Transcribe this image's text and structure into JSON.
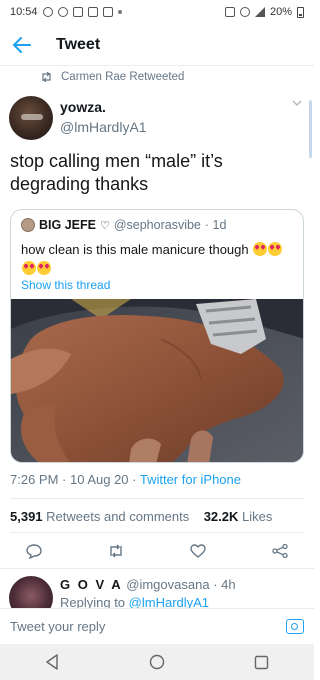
{
  "status_bar": {
    "time": "10:54",
    "battery": "20%"
  },
  "header": {
    "title": "Tweet",
    "back_icon": "arrow-left-icon"
  },
  "retweet_banner": {
    "text": "Carmen Rae Retweeted"
  },
  "tweet": {
    "display_name": "yowza.",
    "handle": "@lmHardlyA1",
    "text": "stop calling men “male” it’s degrading thanks",
    "quote": {
      "name": "BIG JEFE",
      "handle": "@sephorasvibe",
      "time": "· 1d",
      "text": "how clean is this male manicure though",
      "show_thread": "Show this thread"
    },
    "timestamp": "7:26 PM · 10 Aug 20 · ",
    "source": "Twitter for iPhone",
    "retweets_count": "5,391",
    "retweets_label": "Retweets and comments",
    "likes_count": "32.2K",
    "likes_label": "Likes"
  },
  "reply": {
    "name": "G O V A",
    "handle": "@imgovasana",
    "time": "· 4h",
    "replying_prefix": "Replying to ",
    "replying_handle": "@lmHardlyA1"
  },
  "composer": {
    "placeholder": "Tweet your reply"
  },
  "colors": {
    "accent": "#1da1f2",
    "muted": "#657786",
    "border": "#e6ecf0"
  }
}
